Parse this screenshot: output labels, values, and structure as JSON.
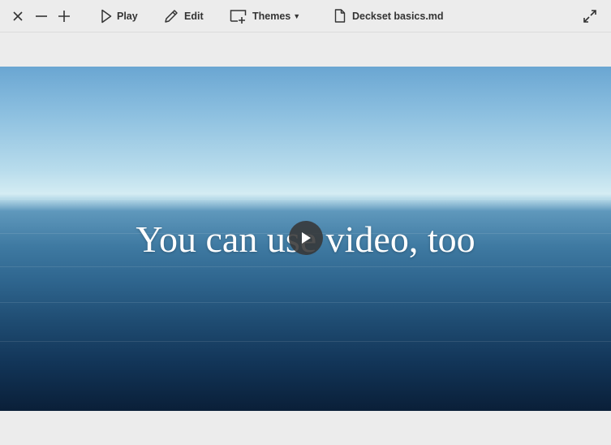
{
  "toolbar": {
    "close_icon": "close-icon",
    "zoom_out_icon": "minus-icon",
    "zoom_in_icon": "plus-icon",
    "play_label": "Play",
    "edit_label": "Edit",
    "themes_label": "Themes",
    "document_title": "Deckset basics.md",
    "fullscreen_icon": "expand-icon"
  },
  "slide": {
    "heading": "You can use video, too",
    "video_control_icon": "play-icon"
  },
  "colors": {
    "toolbar_bg": "#ececec",
    "icon": "#333333",
    "slide_text": "#ffffff",
    "play_overlay": "#373737"
  }
}
